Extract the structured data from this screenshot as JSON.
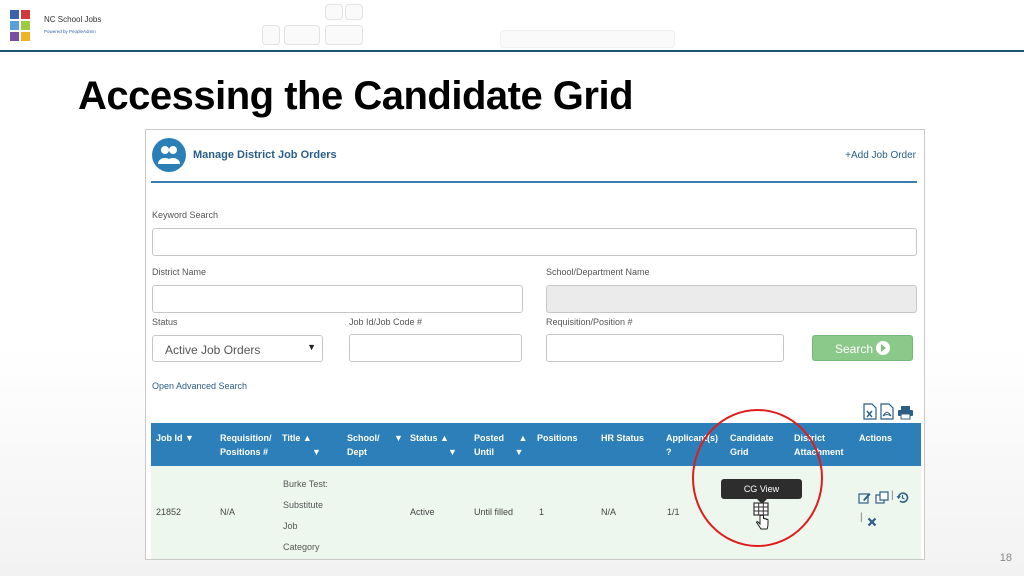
{
  "header": {
    "logo_line1": "NC School Jobs",
    "logo_line2": "Powered by PeopleAdmin"
  },
  "slide": {
    "title": "Accessing the Candidate Grid",
    "page_number": "18"
  },
  "panel": {
    "heading": "Manage District Job Orders",
    "add_link": "+Add Job Order",
    "fields": {
      "keyword_label": "Keyword Search",
      "district_label": "District Name",
      "school_label": "School/Department Name",
      "status_label": "Status",
      "status_value": "Active Job Orders",
      "jobid_label": "Job Id/Job Code #",
      "requisition_label": "Requisition/Position #"
    },
    "search_label": "Search",
    "advanced_link": "Open Advanced Search"
  },
  "table": {
    "columns": [
      {
        "line1": "Job Id",
        "line2": ""
      },
      {
        "line1": "Requisition/",
        "line2": "Positions #"
      },
      {
        "line1": "Title",
        "line2": ""
      },
      {
        "line1": "School/",
        "line2": "Dept"
      },
      {
        "line1": "Status",
        "line2": ""
      },
      {
        "line1": "Posted",
        "line2": "Until"
      },
      {
        "line1": "Positions",
        "line2": ""
      },
      {
        "line1": "HR Status",
        "line2": ""
      },
      {
        "line1": "Applicant(s)",
        "line2": "?"
      },
      {
        "line1": "Candidate",
        "line2": "Grid"
      },
      {
        "line1": "District",
        "line2": "Attachment"
      },
      {
        "line1": "Actions",
        "line2": ""
      }
    ],
    "row": {
      "job_id": "21852",
      "requisition": "N/A",
      "title_lines": [
        "Burke Test:",
        "Substitute",
        "Job",
        "Category"
      ],
      "status": "Active",
      "posted_until": "Until filled",
      "positions": "1",
      "hr_status": "N/A",
      "applicants": "1/1"
    },
    "tooltip": "CG View"
  },
  "icons": {
    "users": "users-icon",
    "grid": "grid-icon",
    "edit": "edit-icon",
    "copy": "copy-icon",
    "history": "history-icon",
    "delete": "close-icon",
    "excel": "excel-icon",
    "pdf": "pdf-icon",
    "print": "print-icon"
  },
  "colors": {
    "accent_blue": "#2c7fb8",
    "search_green": "#8bc98b",
    "highlight_red": "#e01c1c",
    "row_green": "#eef7ee"
  }
}
